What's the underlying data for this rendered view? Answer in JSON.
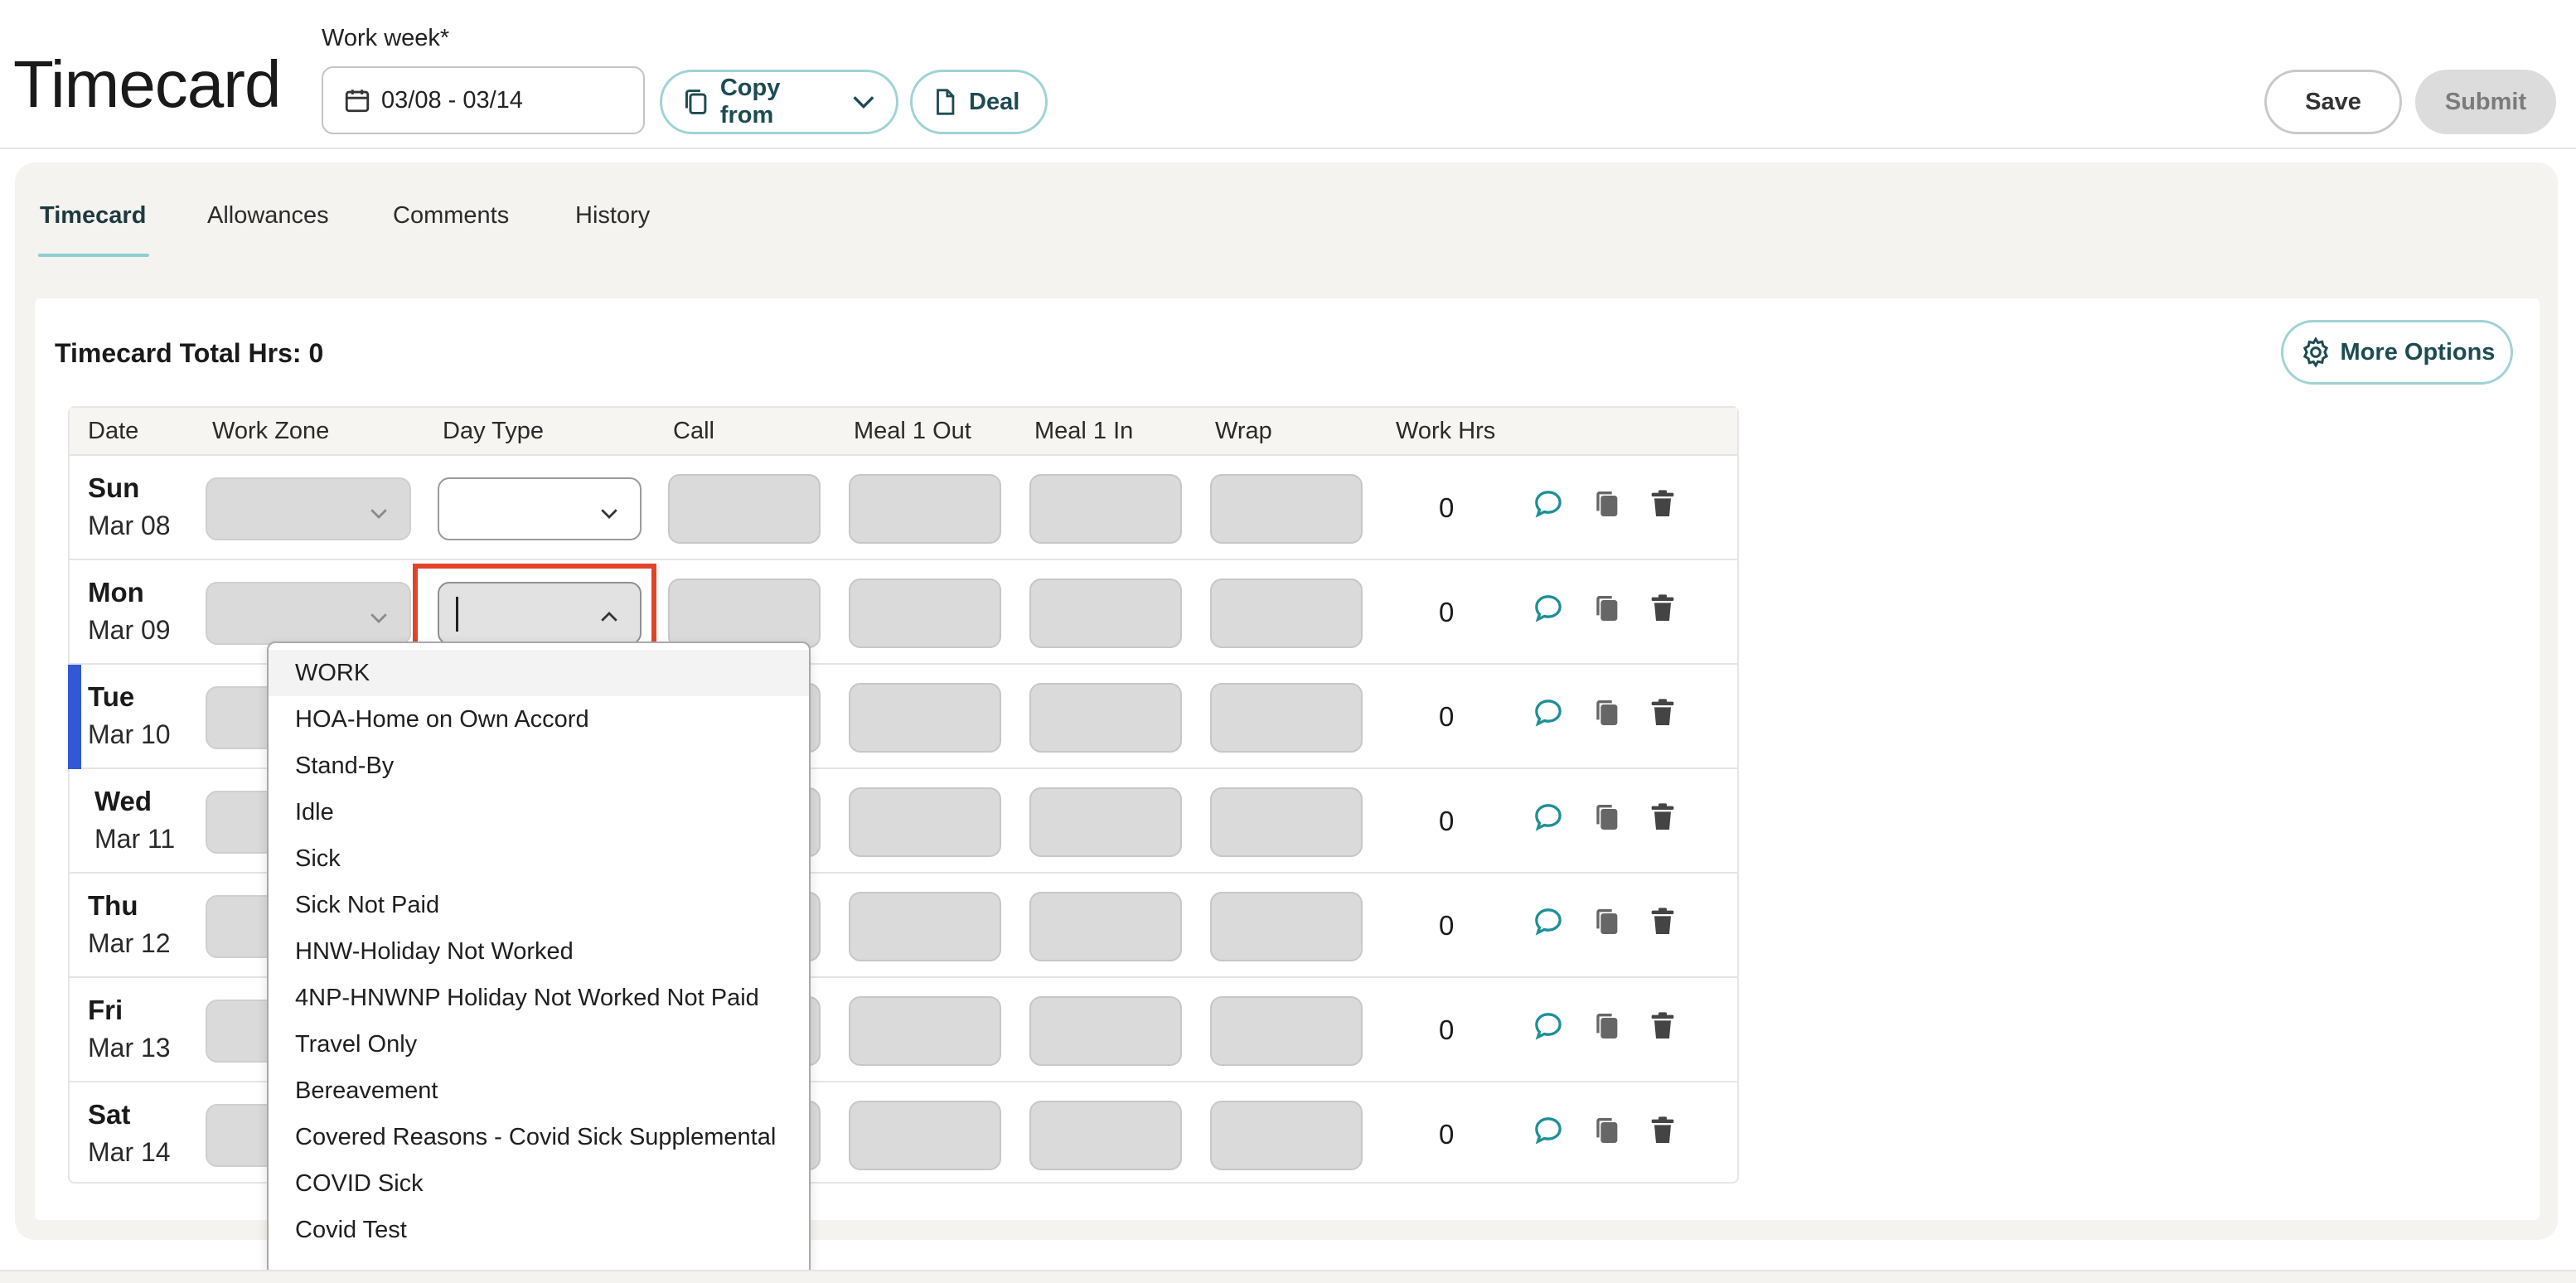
{
  "header": {
    "title": "Timecard",
    "work_week_label": "Work week*",
    "work_week_value": "03/08 - 03/14",
    "copy_from_label": "Copy from",
    "deal_label": "Deal",
    "save_label": "Save",
    "submit_label": "Submit"
  },
  "tabs": [
    {
      "label": "Timecard",
      "active": true
    },
    {
      "label": "Allowances",
      "active": false
    },
    {
      "label": "Comments",
      "active": false
    },
    {
      "label": "History",
      "active": false
    }
  ],
  "summary": {
    "total_label": "Timecard Total Hrs: 0",
    "more_options_label": "More Options"
  },
  "table": {
    "columns": [
      "Date",
      "Work Zone",
      "Day Type",
      "Call",
      "Meal 1 Out",
      "Meal 1 In",
      "Wrap",
      "Work Hrs"
    ],
    "rows": [
      {
        "day": "Sun",
        "date": "Mar 08",
        "work_hrs": "0"
      },
      {
        "day": "Mon",
        "date": "Mar 09",
        "work_hrs": "0"
      },
      {
        "day": "Tue",
        "date": "Mar 10",
        "work_hrs": "0"
      },
      {
        "day": "Wed",
        "date": "Mar 11",
        "work_hrs": "0"
      },
      {
        "day": "Thu",
        "date": "Mar 12",
        "work_hrs": "0"
      },
      {
        "day": "Fri",
        "date": "Mar 13",
        "work_hrs": "0"
      },
      {
        "day": "Sat",
        "date": "Mar 14",
        "work_hrs": "0"
      }
    ],
    "row_action_icons": [
      "comment-icon",
      "copy-icon",
      "trash-icon"
    ]
  },
  "day_type_dropdown": {
    "options": [
      "WORK",
      "HOA-Home on Own Accord",
      "Stand-By",
      "Idle",
      "Sick",
      "Sick Not Paid",
      "HNW-Holiday Not Worked",
      "4NP-HNWNP Holiday Not Worked Not Paid",
      "Travel Only",
      "Bereavement",
      "Covered Reasons - Covid Sick Supplemental",
      "COVID Sick",
      "Covid Test"
    ],
    "highlighted": "WORK"
  },
  "colors": {
    "accent_teal": "#9fd3d4",
    "teal_text": "#1d4b52",
    "today_marker": "#3358d4",
    "focus_outline": "#e2432a",
    "panel_bg": "#f5f3ef"
  }
}
